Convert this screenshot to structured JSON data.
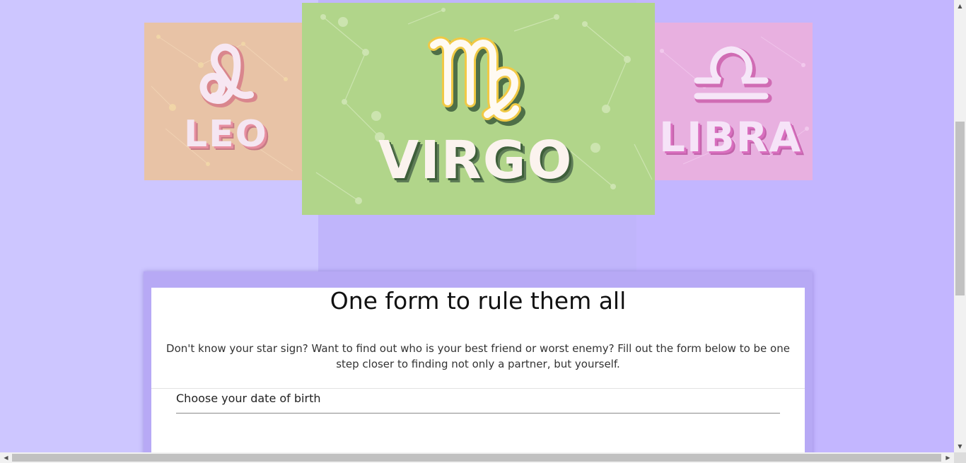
{
  "carousel": {
    "slides": [
      {
        "sign": "LEO",
        "symbol": "♌"
      },
      {
        "sign": "VIRGO",
        "symbol": "♍"
      },
      {
        "sign": "LIBRA",
        "symbol": "♎"
      }
    ]
  },
  "form": {
    "title": "One form to rule them all",
    "description": "Don't know your star sign? Want to find out who is your best friend or worst enemy? Fill out the form below to be one step closer to finding not only a partner, but yourself.",
    "dob_label": "Choose your date of birth"
  },
  "scrollbars": {
    "up_icon": "▲",
    "down_icon": "▼",
    "left_icon": "◀",
    "right_icon": "▶"
  },
  "colors": {
    "page_background": "#c9c2ff",
    "leo_card": "#e8c3a6",
    "virgo_card": "#b1d58a",
    "libra_card": "#e8b0e0"
  }
}
